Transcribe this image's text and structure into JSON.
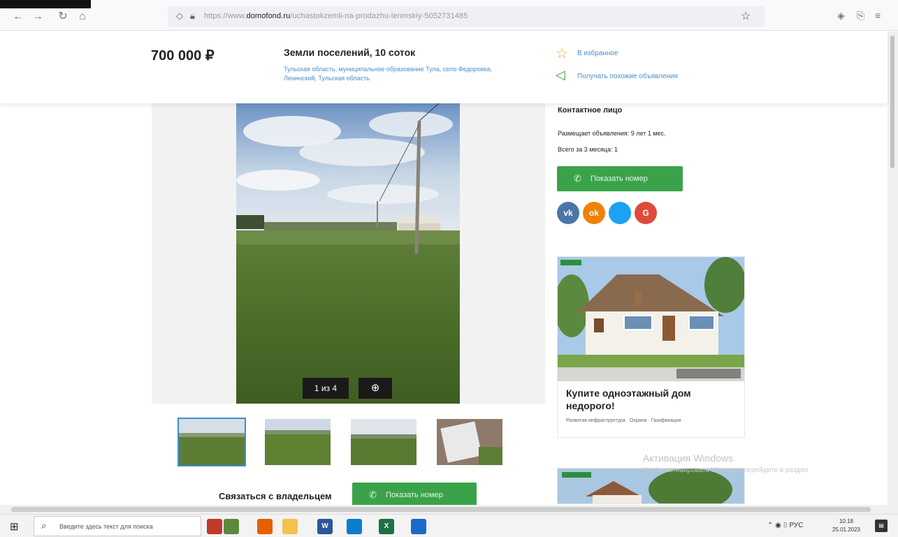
{
  "browser": {
    "url_prefix": "https://www.",
    "url_domain": "domofond.ru",
    "url_path": "/uchastokzemli-na-prodazhu-lenmskiy-5052731485"
  },
  "listing": {
    "price": "700 000 ₽",
    "title": "Земли поселений, 10 соток",
    "address": "Тульская область, муниципальное образование Тула, село Федоровка, Ленинский, Тульская область",
    "favorite_label": "В избранное",
    "subscribe_label": "Получать похожие объявления"
  },
  "gallery": {
    "counter": "1 из 4",
    "zoom_icon": "zoom-icon"
  },
  "contact": {
    "title": "Контактное лицо",
    "posting_since": "Размещает объявления: 9 лет 1 мес.",
    "posted_count": "Всего за 3 месяца: 1",
    "show_number_label": "Показать номер",
    "owner_label": "Связаться с владельцем",
    "social": [
      "vk",
      "ok",
      "twitter",
      "google"
    ],
    "social_labels": [
      "vk",
      "ok",
      "",
      "G"
    ]
  },
  "ad": {
    "title": "Купите одноэтажный дом недорого!",
    "description": "Развитая инфраструктура · Охрана · Газификация"
  },
  "windows_activation": {
    "title": "Активация Windows",
    "subtitle": "Чтобы активировать Windows, перейдите в раздел"
  },
  "taskbar": {
    "search_placeholder": "Введите здесь текст для поиска",
    "tray_lang": "РУС",
    "time": "10:18",
    "date": "25.01.2023"
  },
  "colors": {
    "accent_green": "#3aa34a",
    "link_blue": "#4a8fc9",
    "vk": "#4a76a8",
    "ok": "#ee8208",
    "twitter": "#1da1f2",
    "google": "#dd4b39"
  }
}
